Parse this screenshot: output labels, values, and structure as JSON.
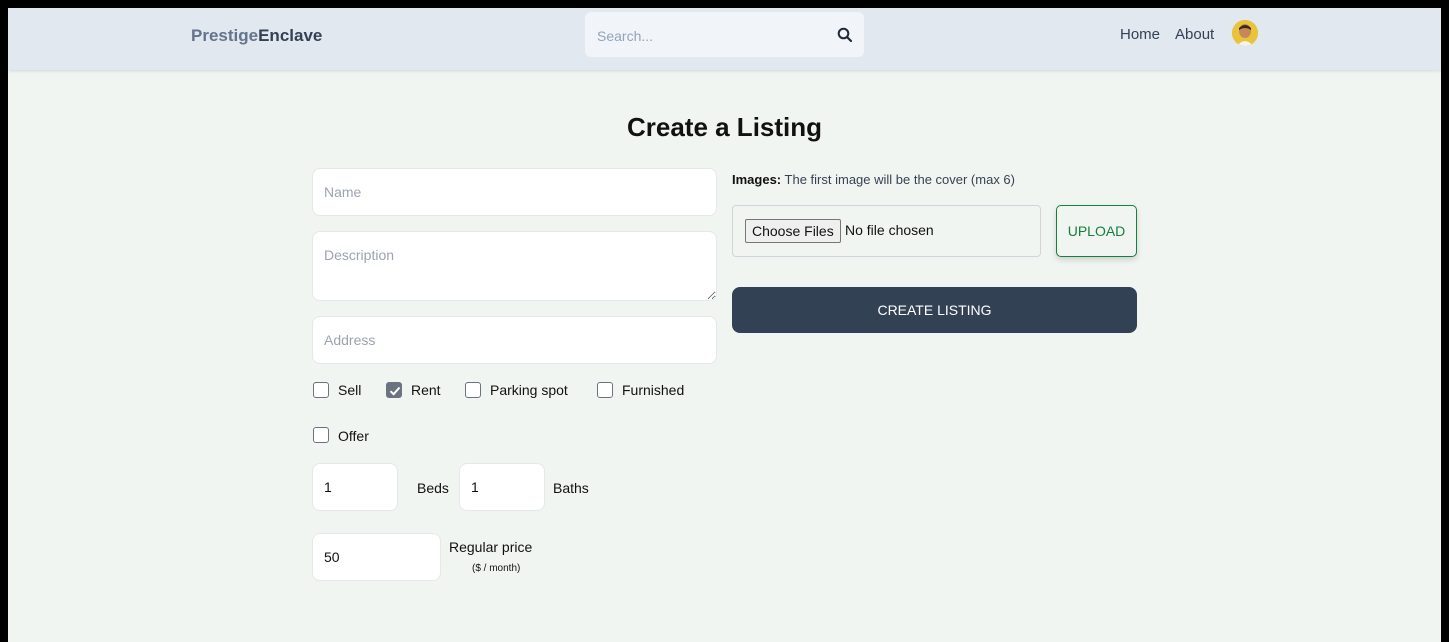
{
  "header": {
    "logo_part1": "Prestige",
    "logo_part2": "Enclave",
    "search_placeholder": "Search...",
    "search_icon": "search-icon",
    "nav_home": "Home",
    "nav_about": "About",
    "avatar_icon": "user-avatar"
  },
  "main": {
    "title": "Create a Listing",
    "name_placeholder": "Name",
    "description_placeholder": "Description",
    "address_placeholder": "Address",
    "checkboxes": [
      {
        "label": "Sell",
        "checked": false
      },
      {
        "label": "Rent",
        "checked": true
      },
      {
        "label": "Parking spot",
        "checked": false
      },
      {
        "label": "Furnished",
        "checked": false
      },
      {
        "label": "Offer",
        "checked": false
      }
    ],
    "beds_value": "1",
    "beds_label": "Beds",
    "baths_value": "1",
    "baths_label": "Baths",
    "price_value": "50",
    "price_label": "Regular price",
    "price_unit": "($ / month)"
  },
  "images": {
    "label_bold": "Images:",
    "label_text": "The first image will be the cover (max 6)",
    "choose_files": "Choose Files",
    "no_file": "No file chosen",
    "upload": "UPLOAD"
  },
  "create_listing": "CREATE LISTING",
  "colors": {
    "header_bg": "#e2e8f0",
    "page_bg": "#f1f5f1",
    "primary_button": "#334155",
    "upload_accent": "#15803d"
  }
}
